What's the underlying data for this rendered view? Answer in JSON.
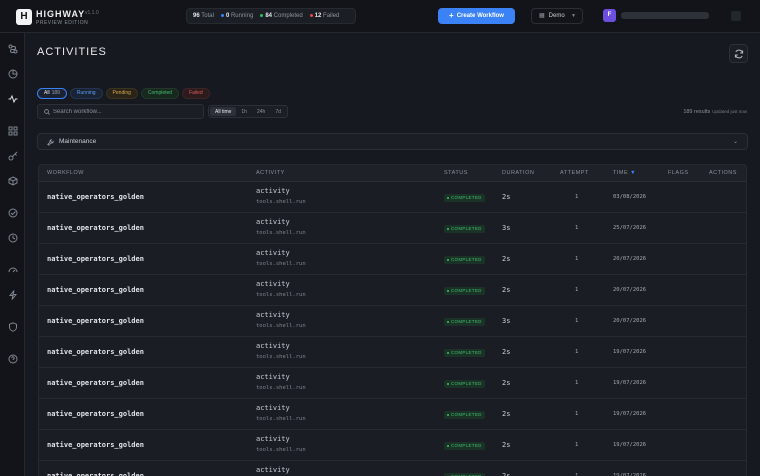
{
  "app": {
    "logo_letter": "H",
    "name": "HIGHWAY",
    "version": "v1.1.0",
    "edition": "PREVIEW EDITION"
  },
  "stats": {
    "total_value": "96",
    "total_label": "Total",
    "running_value": "0",
    "running_label": "Running",
    "completed_value": "84",
    "completed_label": "Completed",
    "failed_value": "12",
    "failed_label": "Failed"
  },
  "header": {
    "create_label": "Create Workflow",
    "workspace": "Demo",
    "avatar_letter": "F"
  },
  "colors": {
    "accent": "#3b82f6",
    "running": "#3b82f6",
    "completed": "#22c55e",
    "failed": "#ef4444"
  },
  "sidebar": {
    "items": [
      "workflows-icon",
      "history-icon",
      "activities-icon",
      "apps-icon",
      "keys-icon",
      "package-icon",
      "check-icon",
      "clock-icon",
      "gauge-icon",
      "bolt-icon",
      "shield-icon",
      "help-icon"
    ]
  },
  "page": {
    "title": "ACTIVITIES"
  },
  "filters": {
    "all_label": "All",
    "all_count": "189",
    "running": "Running",
    "pending": "Pending",
    "completed": "Completed",
    "failed": "Failed"
  },
  "search": {
    "placeholder": "Search workflow..."
  },
  "time_range": {
    "all": "All time",
    "h1": "1h",
    "h24": "24h",
    "d7": "7d"
  },
  "results": {
    "count": "189 results",
    "updated": "Updated just now"
  },
  "maintenance": {
    "label": "Maintenance"
  },
  "table": {
    "headers": {
      "workflow": "WORKFLOW",
      "activity": "ACTIVITY",
      "status": "STATUS",
      "duration": "DURATION",
      "attempt": "ATTEMPT",
      "time": "TIME",
      "flags": "FLAGS",
      "actions": "ACTIONS"
    },
    "rows": [
      {
        "workflow": "native_operators_golden",
        "activity": "activity",
        "sub": "tools.shell.run",
        "status": "COMPLETED",
        "duration": "2s",
        "attempt": "1",
        "time": "03/08/2026"
      },
      {
        "workflow": "native_operators_golden",
        "activity": "activity",
        "sub": "tools.shell.run",
        "status": "COMPLETED",
        "duration": "3s",
        "attempt": "1",
        "time": "25/07/2026"
      },
      {
        "workflow": "native_operators_golden",
        "activity": "activity",
        "sub": "tools.shell.run",
        "status": "COMPLETED",
        "duration": "2s",
        "attempt": "1",
        "time": "20/07/2026"
      },
      {
        "workflow": "native_operators_golden",
        "activity": "activity",
        "sub": "tools.shell.run",
        "status": "COMPLETED",
        "duration": "2s",
        "attempt": "1",
        "time": "20/07/2026"
      },
      {
        "workflow": "native_operators_golden",
        "activity": "activity",
        "sub": "tools.shell.run",
        "status": "COMPLETED",
        "duration": "3s",
        "attempt": "1",
        "time": "20/07/2026"
      },
      {
        "workflow": "native_operators_golden",
        "activity": "activity",
        "sub": "tools.shell.run",
        "status": "COMPLETED",
        "duration": "2s",
        "attempt": "1",
        "time": "19/07/2026"
      },
      {
        "workflow": "native_operators_golden",
        "activity": "activity",
        "sub": "tools.shell.run",
        "status": "COMPLETED",
        "duration": "2s",
        "attempt": "1",
        "time": "19/07/2026"
      },
      {
        "workflow": "native_operators_golden",
        "activity": "activity",
        "sub": "tools.shell.run",
        "status": "COMPLETED",
        "duration": "2s",
        "attempt": "1",
        "time": "19/07/2026"
      },
      {
        "workflow": "native_operators_golden",
        "activity": "activity",
        "sub": "tools.shell.run",
        "status": "COMPLETED",
        "duration": "2s",
        "attempt": "1",
        "time": "19/07/2026"
      },
      {
        "workflow": "native_operators_golden",
        "activity": "activity",
        "sub": "tools.shell.run",
        "status": "COMPLETED",
        "duration": "2s",
        "attempt": "1",
        "time": "19/07/2026"
      }
    ]
  }
}
